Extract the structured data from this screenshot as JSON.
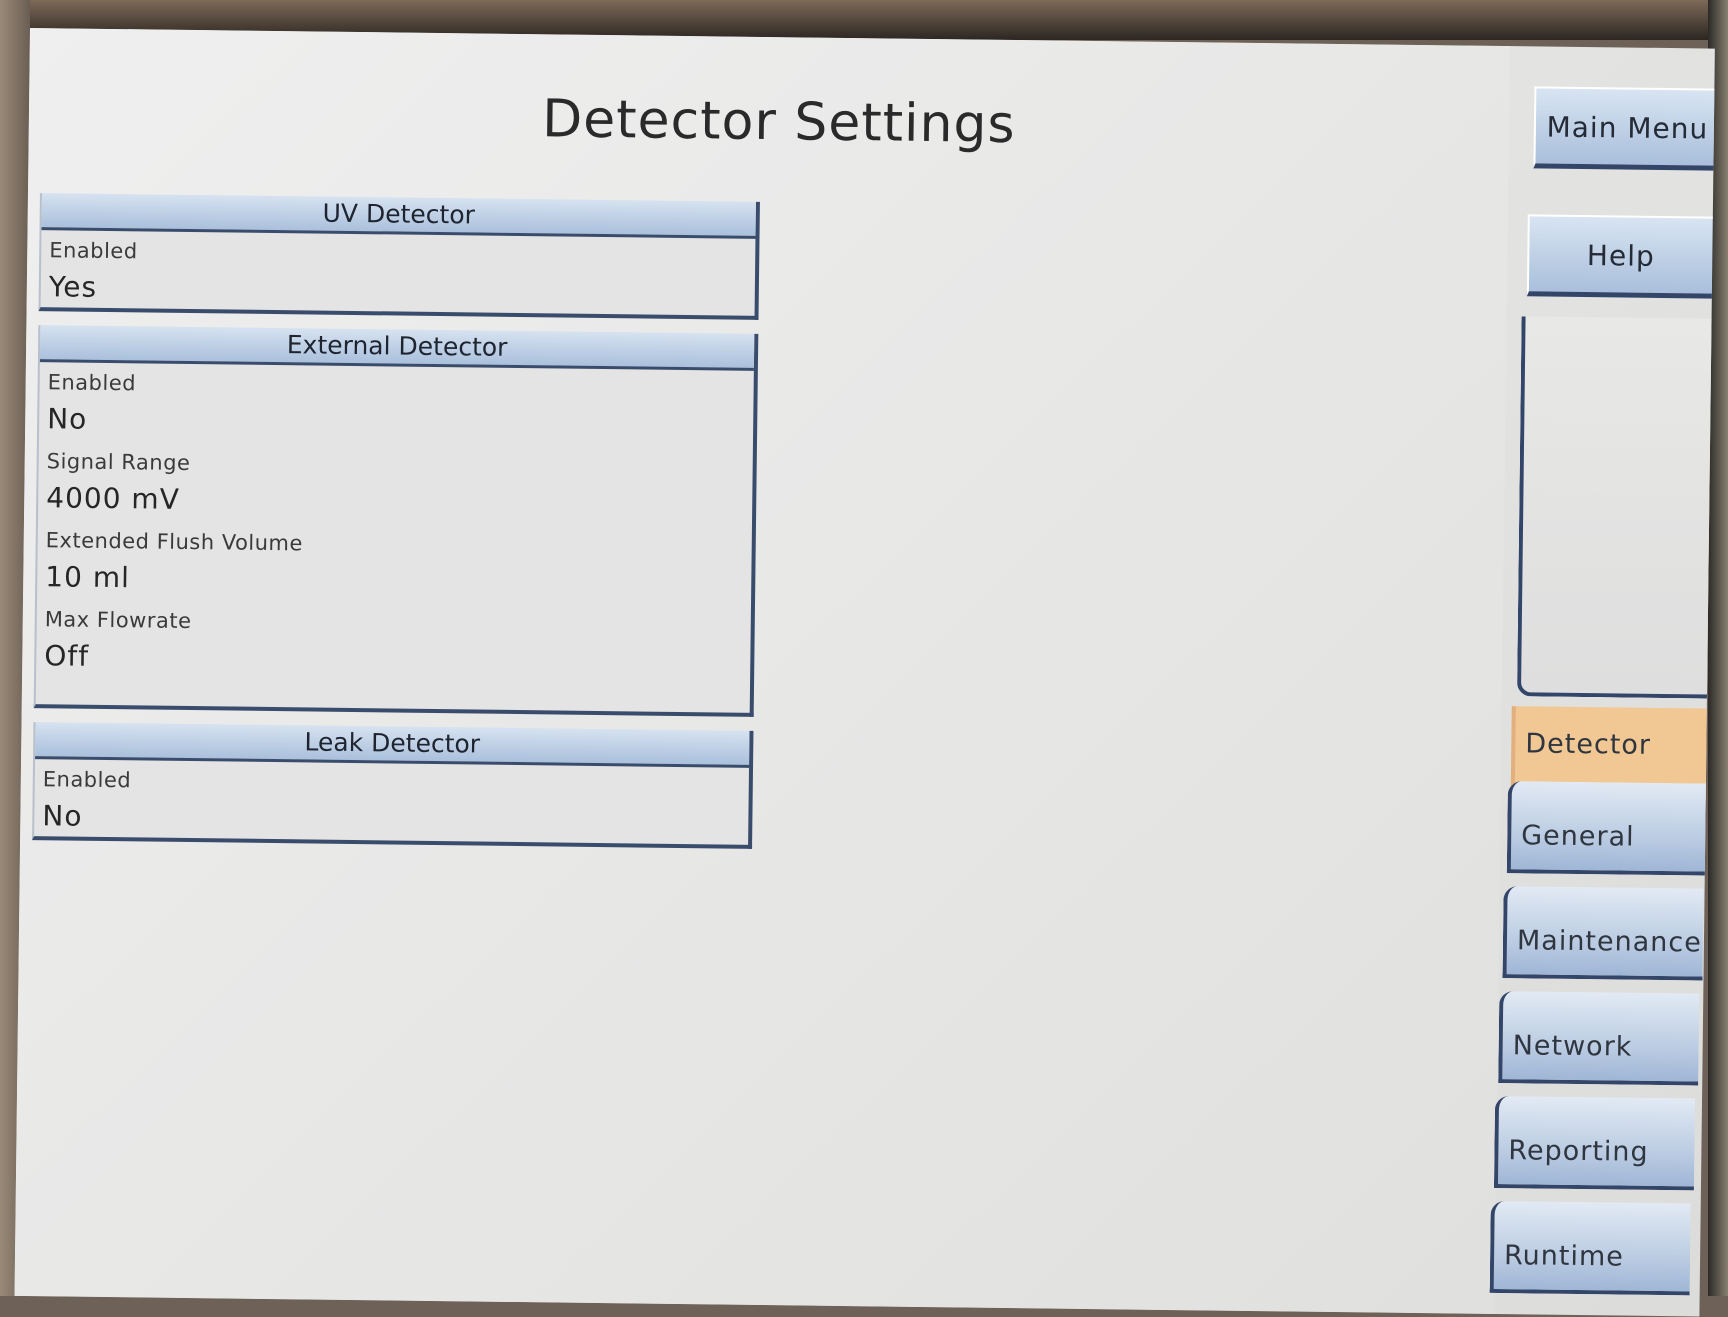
{
  "header": {
    "title": "Detector Settings"
  },
  "panels": {
    "uv": {
      "title": "UV Detector",
      "fields": [
        {
          "label": "Enabled",
          "value": "Yes"
        }
      ]
    },
    "external": {
      "title": "External Detector",
      "fields": [
        {
          "label": "Enabled",
          "value": "No"
        },
        {
          "label": "Signal Range",
          "value": "4000 mV"
        },
        {
          "label": "Extended Flush Volume",
          "value": "10 ml"
        },
        {
          "label": "Max Flowrate",
          "value": "Off"
        }
      ]
    },
    "leak": {
      "title": "Leak Detector",
      "fields": [
        {
          "label": "Enabled",
          "value": "No"
        }
      ]
    }
  },
  "sidebar": {
    "main_menu": "Main Menu",
    "help": "Help",
    "tabs": [
      {
        "label": "Detector",
        "active": true
      },
      {
        "label": "General",
        "active": false
      },
      {
        "label": "Maintenance",
        "active": false
      },
      {
        "label": "Network",
        "active": false
      },
      {
        "label": "Reporting",
        "active": false
      },
      {
        "label": "Runtime",
        "active": false
      }
    ]
  },
  "colors": {
    "header_gradient_top": "#d6e2f0",
    "header_gradient_bottom": "#aac0dc",
    "border_dark_blue": "#3a4c6c",
    "active_tab": "#f1c894",
    "screen_background": "#e6e6e4"
  }
}
